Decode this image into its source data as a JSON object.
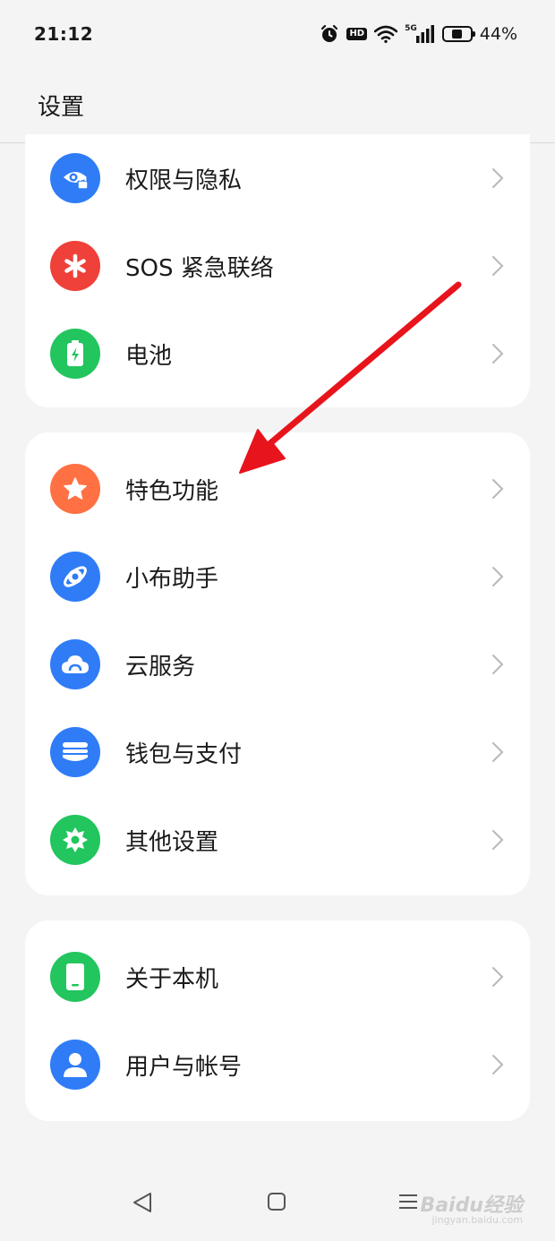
{
  "status_bar": {
    "time": "21:12",
    "hd": "HD",
    "network": "5G",
    "battery_percent_text": "44%",
    "battery_level": 0.44,
    "icons": [
      "alarm-icon",
      "hd-icon",
      "wifi-icon",
      "signal-icon",
      "battery-icon"
    ]
  },
  "header": {
    "title": "设置"
  },
  "groups": [
    {
      "items": [
        {
          "label": "权限与隐私",
          "icon": "privacy-eye-lock-icon",
          "color": "#2f7cf6"
        },
        {
          "label": "SOS 紧急联络",
          "icon": "asterisk-icon",
          "color": "#f0403a"
        },
        {
          "label": "电池",
          "icon": "battery-charging-icon",
          "color": "#22c55e"
        }
      ]
    },
    {
      "items": [
        {
          "label": "特色功能",
          "icon": "star-icon",
          "color": "#ff7043"
        },
        {
          "label": "小布助手",
          "icon": "assistant-orbit-icon",
          "color": "#2f7cf6"
        },
        {
          "label": "云服务",
          "icon": "cloud-icon",
          "color": "#2f7cf6"
        },
        {
          "label": "钱包与支付",
          "icon": "wallet-icon",
          "color": "#2f7cf6"
        },
        {
          "label": "其他设置",
          "icon": "gear-icon",
          "color": "#22c55e"
        }
      ]
    },
    {
      "items": [
        {
          "label": "关于本机",
          "icon": "phone-icon",
          "color": "#22c55e"
        },
        {
          "label": "用户与帐号",
          "icon": "user-icon",
          "color": "#2f7cf6"
        }
      ]
    }
  ],
  "nav_bar": {
    "icons": [
      "back-icon",
      "home-icon",
      "recents-menu-icon"
    ]
  },
  "watermark": {
    "text": "Baidu经验",
    "sub": "jingyan.baidu.com"
  },
  "annotation": {
    "color": "#e8141c"
  }
}
